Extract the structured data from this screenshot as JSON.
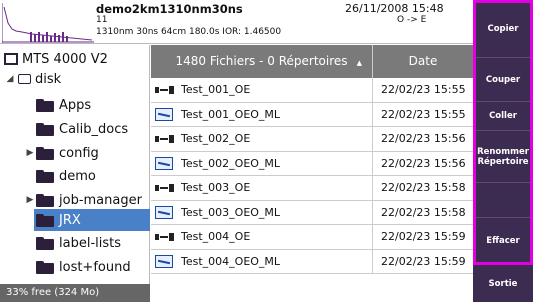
{
  "header": {
    "file_name": "demo2km1310nm30ns",
    "datetime": "26/11/2008 15:48",
    "line2": "11",
    "direction": "O -> E",
    "line3": "1310nm  30ns  64cm  180.0s  IOR: 1.46500"
  },
  "tree": {
    "items": [
      {
        "label": "MTS 4000 V2"
      },
      {
        "label": "disk",
        "expander": "◢"
      },
      {
        "label": "Apps"
      },
      {
        "label": "Calib_docs"
      },
      {
        "label": "config",
        "expander": "▶"
      },
      {
        "label": "demo"
      },
      {
        "label": "job-manager",
        "expander": "▶"
      },
      {
        "label": "JRX"
      },
      {
        "label": "label-lists"
      },
      {
        "label": "lost+found"
      }
    ],
    "status": "33% free (324 Mo)"
  },
  "table": {
    "header_name": "1480 Fichiers - 0 Répertoires",
    "header_date": "Date",
    "rows": [
      {
        "name": "Test_001_OE",
        "date": "22/02/23 15:55",
        "icon": "oe-trace-icon"
      },
      {
        "name": "Test_001_OEO_ML",
        "date": "22/02/23 15:55",
        "icon": "oeo-trace-icon"
      },
      {
        "name": "Test_002_OE",
        "date": "22/02/23 15:56",
        "icon": "oe-trace-icon"
      },
      {
        "name": "Test_002_OEO_ML",
        "date": "22/02/23 15:56",
        "icon": "oeo-trace-icon"
      },
      {
        "name": "Test_003_OE",
        "date": "22/02/23 15:58",
        "icon": "oe-trace-icon"
      },
      {
        "name": "Test_003_OEO_ML",
        "date": "22/02/23 15:58",
        "icon": "oeo-trace-icon"
      },
      {
        "name": "Test_004_OE",
        "date": "22/02/23 15:59",
        "icon": "oe-trace-icon"
      },
      {
        "name": "Test_004_OEO_ML",
        "date": "22/02/23 15:59",
        "icon": "oeo-trace-icon"
      }
    ]
  },
  "sidebar": {
    "copy": "Copier",
    "cut": "Couper",
    "paste": "Coller",
    "rename_1": "Renommer",
    "rename_2": "Répertoire",
    "delete": "Effacer",
    "exit": "Sortie"
  },
  "colors": {
    "selection": "#4a80c8",
    "sidebar_bg": "#3d2c52",
    "highlight_frame": "#e100e1",
    "table_header": "#7a7a7a"
  }
}
